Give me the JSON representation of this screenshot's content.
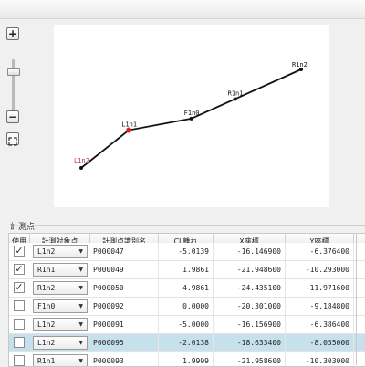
{
  "zoom": {
    "in_label": "+",
    "out_label": "−",
    "level": 0.2
  },
  "plot": {
    "points": [
      {
        "name": "L1n2",
        "x": -16.1569,
        "y": -6.3864,
        "color": "#b0306a",
        "highlight": false
      },
      {
        "name": "L1n1",
        "x": -17.95,
        "y": -8.53,
        "color": "#111111",
        "highlight": true
      },
      {
        "name": "F1n0",
        "x": -20.301,
        "y": -9.1848,
        "color": "#111111",
        "highlight": false
      },
      {
        "name": "R1n1",
        "x": -21.9486,
        "y": -10.293,
        "color": "#111111",
        "highlight": false
      },
      {
        "name": "R1n2",
        "x": -24.4351,
        "y": -11.9716,
        "color": "#111111",
        "highlight": false
      }
    ],
    "highlight_color": "#e02020",
    "line_color": "#111111"
  },
  "section": {
    "title": "計測点"
  },
  "grid": {
    "headers": [
      "使用",
      "計測対象点",
      "計測点識別名",
      "CL離れ",
      "X座標",
      "Y座標"
    ],
    "rows": [
      {
        "checked": true,
        "target": "L1n2",
        "id": "P000047",
        "cl": "-5.0139",
        "x": "-16.146900",
        "y": "-6.376400",
        "selected": false
      },
      {
        "checked": true,
        "target": "R1n1",
        "id": "P000049",
        "cl": "1.9861",
        "x": "-21.948600",
        "y": "-10.293000",
        "selected": false
      },
      {
        "checked": true,
        "target": "R1n2",
        "id": "P000050",
        "cl": "4.9861",
        "x": "-24.435100",
        "y": "-11.971600",
        "selected": false
      },
      {
        "checked": false,
        "target": "F1n0",
        "id": "P000092",
        "cl": "0.0000",
        "x": "-20.301000",
        "y": "-9.184800",
        "selected": false
      },
      {
        "checked": false,
        "target": "L1n2",
        "id": "P000091",
        "cl": "-5.0000",
        "x": "-16.156900",
        "y": "-6.386400",
        "selected": false
      },
      {
        "checked": false,
        "target": "L1n2",
        "id": "P000095",
        "cl": "-2.0138",
        "x": "-18.633400",
        "y": "-8.055000",
        "selected": true
      },
      {
        "checked": false,
        "target": "R1n1",
        "id": "P000093",
        "cl": "1.9999",
        "x": "-21.958600",
        "y": "-10.303000",
        "selected": false
      }
    ]
  }
}
